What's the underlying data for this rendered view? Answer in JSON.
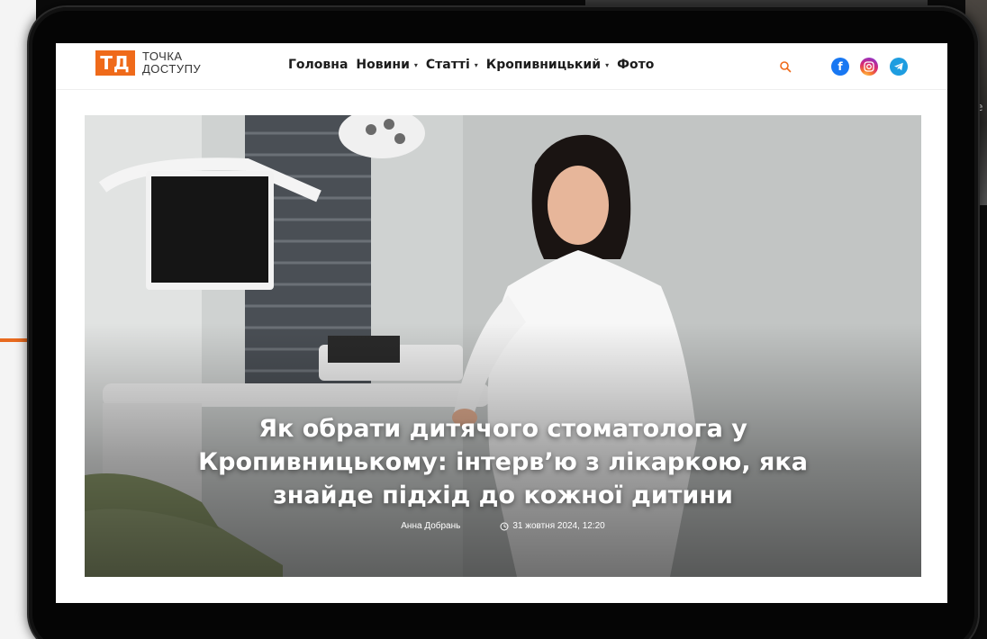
{
  "site": {
    "logo_mark": "ТД",
    "logo_line1": "ТОЧКА",
    "logo_line2": "ДОСТУПУ",
    "brand_color": "#ef6a1a"
  },
  "nav": {
    "items": [
      {
        "label": "Головна",
        "dropdown": false
      },
      {
        "label": "Новини",
        "dropdown": true
      },
      {
        "label": "Статті",
        "dropdown": true
      },
      {
        "label": "Кропивницький",
        "dropdown": true
      },
      {
        "label": "Фото",
        "dropdown": false
      }
    ],
    "caret": "▾"
  },
  "header_icons": {
    "search": "search-icon",
    "social": [
      {
        "name": "facebook-icon",
        "glyph": "f",
        "color": "#1877f2"
      },
      {
        "name": "instagram-icon",
        "glyph": "◎",
        "color": "#d62976"
      },
      {
        "name": "telegram-icon",
        "glyph": "➤",
        "color": "#1e9de0"
      }
    ]
  },
  "hero": {
    "title": "Як обрати дитячого стоматолога у Кропивницькому: інтерв’ю з лікаркою, яка знайде підхід до кожної дитини",
    "author": "Анна Добрань",
    "date": "31 жовтня 2024, 12:20"
  },
  "background": {
    "right_fragment": "e"
  }
}
